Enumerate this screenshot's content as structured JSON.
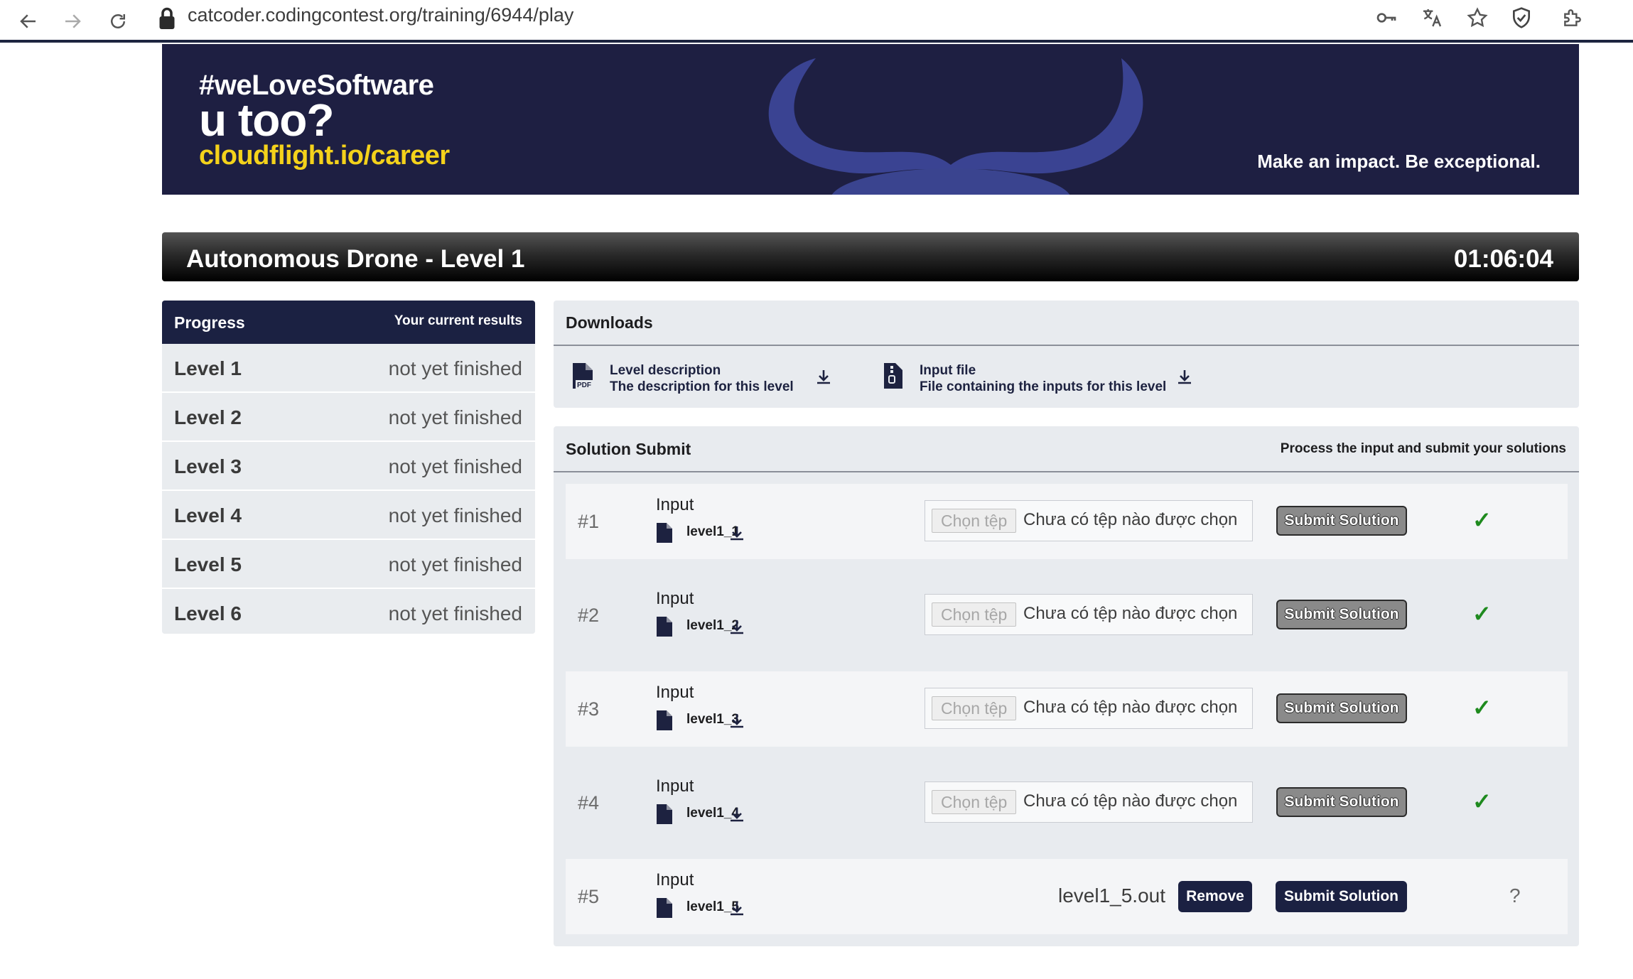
{
  "browser": {
    "url": "catcoder.codingcontest.org/training/6944/play"
  },
  "banner": {
    "line1": "#weLoveSoftware",
    "line2": "u too?",
    "line3": "cloudflight.io/career",
    "slogan": "Make an impact. Be exceptional.",
    "colors": {
      "background": "#1e1f42",
      "accent": "#f4d21b",
      "horns": "#3f4aa0"
    }
  },
  "level": {
    "title": "Autonomous Drone - Level 1",
    "timer": "01:06:04"
  },
  "progress": {
    "header_left": "Progress",
    "header_right": "Your current results",
    "levels": [
      {
        "name": "Level 1",
        "status": "not yet finished"
      },
      {
        "name": "Level 2",
        "status": "not yet finished"
      },
      {
        "name": "Level 3",
        "status": "not yet finished"
      },
      {
        "name": "Level 4",
        "status": "not yet finished"
      },
      {
        "name": "Level 5",
        "status": "not yet finished"
      },
      {
        "name": "Level 6",
        "status": "not yet finished"
      }
    ]
  },
  "downloads": {
    "title": "Downloads",
    "items": [
      {
        "title": "Level description",
        "subtitle": "The description for this level",
        "icon": "pdf-file-icon"
      },
      {
        "title": "Input file",
        "subtitle": "File containing the inputs for this level",
        "icon": "zip-file-icon"
      }
    ]
  },
  "submit": {
    "title": "Solution Submit",
    "subtitle": "Process the input and submit your solutions",
    "input_label": "Input",
    "choose_file_label": "Chọn tệp",
    "no_file_label": "Chưa có tệp nào được chọn",
    "submit_label": "Submit Solution",
    "remove_label": "Remove",
    "rows": [
      {
        "num": "#1",
        "file": "level1_1",
        "status": "✓"
      },
      {
        "num": "#2",
        "file": "level1_2",
        "status": "✓"
      },
      {
        "num": "#3",
        "file": "level1_3",
        "status": "✓"
      },
      {
        "num": "#4",
        "file": "level1_4",
        "status": "✓"
      },
      {
        "num": "#5",
        "file": "level1_5",
        "selected_file": "level1_5.out",
        "status": "?"
      }
    ]
  }
}
